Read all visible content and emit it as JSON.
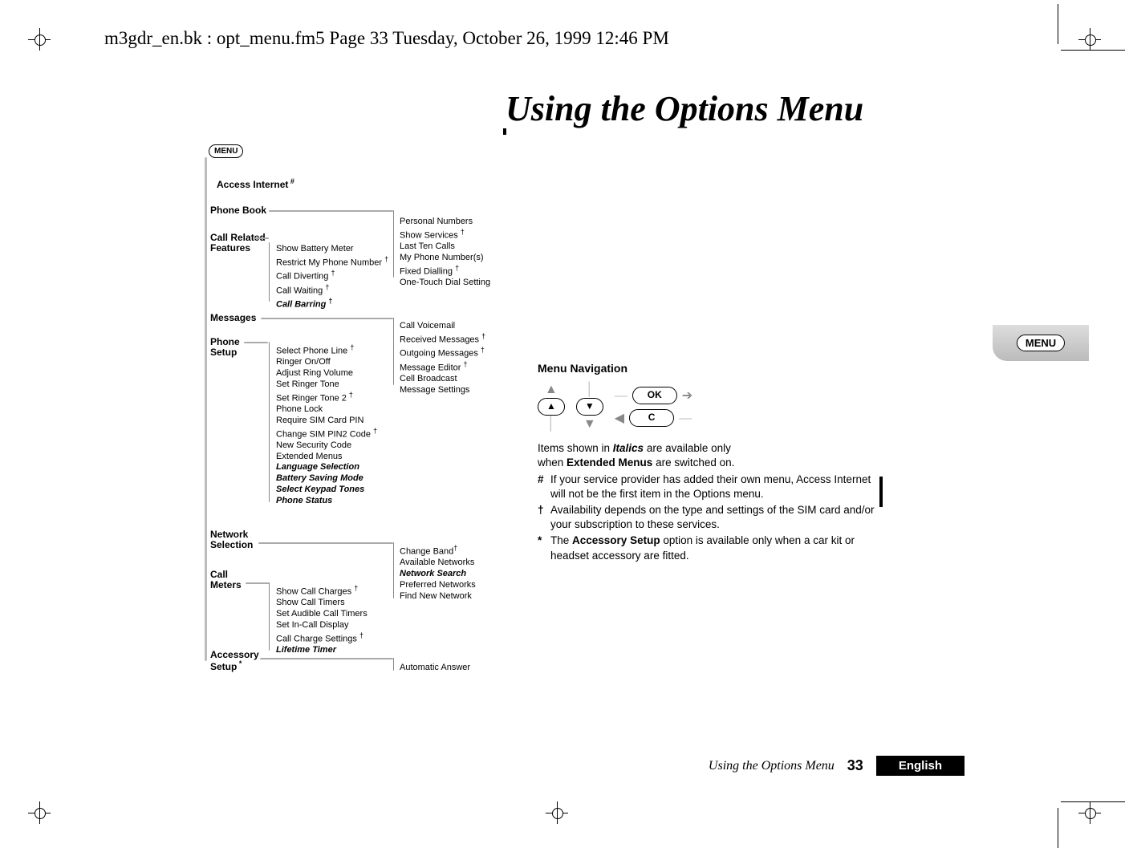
{
  "header": "m3gdr_en.bk : opt_menu.fm5  Page 33  Tuesday, October 26, 1999  12:46 PM",
  "title": "Using the Options Menu",
  "tab_label": "MENU",
  "footer": {
    "title": "Using the Options Menu",
    "page": "33",
    "language": "English"
  },
  "tree": {
    "root_label": "MENU",
    "items": [
      "Access Internet",
      "Phone Book",
      "Call Related\nFeatures",
      "Messages",
      "Phone\nSetup",
      "Network\nSelection",
      "Call\nMeters",
      "Accessory\nSetup"
    ],
    "hash_on": "Access Internet",
    "star_on": "Accessory Setup",
    "phonebook_sub": [
      "Personal Numbers",
      {
        "label": "Show Services",
        "dag": true
      },
      "Last Ten Calls",
      "My Phone Number(s)",
      {
        "label": "Fixed Dialling",
        "dag": true
      },
      "One-Touch Dial Setting"
    ],
    "callrelated_sub": [
      "Show Battery Meter",
      {
        "label": "Restrict My Phone Number",
        "dag": true
      },
      {
        "label": "Call Diverting",
        "dag": true
      },
      {
        "label": "Call Waiting",
        "dag": true
      },
      {
        "label": "Call Barring",
        "dag": true,
        "ital": true
      }
    ],
    "messages_sub": [
      "Call Voicemail",
      {
        "label": "Received Messages",
        "dag": true
      },
      {
        "label": "Outgoing Messages",
        "dag": true
      },
      {
        "label": "Message Editor",
        "dag": true
      },
      "Cell Broadcast",
      "Message Settings"
    ],
    "phonesetup_sub": [
      {
        "label": "Select Phone Line",
        "dag": true
      },
      "Ringer On/Off",
      "Adjust Ring Volume",
      "Set Ringer Tone",
      {
        "label": "Set Ringer Tone 2",
        "dag": true
      },
      "Phone Lock",
      "Require SIM Card PIN",
      {
        "label": "Change SIM PIN2 Code",
        "dag": true
      },
      "New Security Code",
      "Extended Menus",
      {
        "label": "Language Selection",
        "ital": true
      },
      {
        "label": "Battery Saving Mode",
        "ital": true
      },
      {
        "label": "Select Keypad Tones",
        "ital": true
      },
      {
        "label": "Phone Status",
        "ital": true
      }
    ],
    "network_sub": [
      {
        "label": "Change Band",
        "dag": true
      },
      "Available Networks",
      {
        "label": "Network Search",
        "ital": true
      },
      "Preferred Networks",
      "Find New Network"
    ],
    "callmeters_sub": [
      {
        "label": "Show Call Charges",
        "dag": true
      },
      "Show Call Timers",
      "Set Audible Call Timers",
      "Set In-Call Display",
      {
        "label": "Call Charge Settings",
        "dag": true
      },
      {
        "label": "Lifetime Timer",
        "ital": true
      }
    ],
    "accessory_sub": [
      "Automatic Answer"
    ]
  },
  "right": {
    "heading": "Menu Navigation",
    "buttons": {
      "ok": "OK",
      "c": "C",
      "up": "▲",
      "down": "▼"
    },
    "intro_line1_pre": "Items shown in ",
    "intro_line1_em": "Italics",
    "intro_line1_post": " are available only",
    "intro_line2_pre": "when ",
    "intro_line2_b": "Extended Menus",
    "intro_line2_post": " are switched on.",
    "notes": [
      {
        "mark": "#",
        "text": "If your service provider has added their own menu, Access Internet will not be the first item in the Options menu."
      },
      {
        "mark": "†",
        "text": "Availability depends on the type and settings of the SIM card and/or your subscription to these services."
      },
      {
        "mark": "*",
        "text_pre": "The ",
        "text_b": "Accessory Setup",
        "text_post": " option is available only when a car kit or headset accessory are fitted."
      }
    ]
  }
}
